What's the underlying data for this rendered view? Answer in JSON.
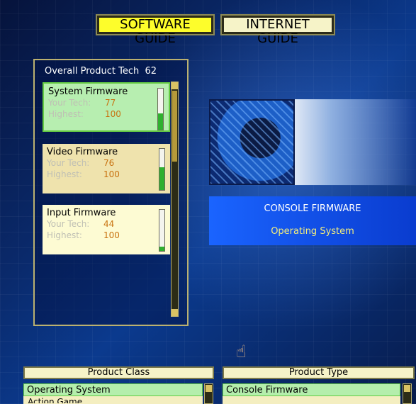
{
  "tabs": {
    "software_guide": "SOFTWARE GUIDE",
    "internet_guide": "INTERNET GUIDE"
  },
  "tech_panel": {
    "overall_label": "Overall Product Tech",
    "overall_value": "62",
    "your_tech_label": "Your Tech:",
    "highest_label": "Highest:",
    "cards": [
      {
        "name": "System Firmware",
        "your_tech": "77",
        "highest": "100",
        "level_fraction": 0.4
      },
      {
        "name": "Video Firmware",
        "your_tech": "76",
        "highest": "100",
        "level_fraction": 0.55
      },
      {
        "name": "Input Firmware",
        "your_tech": "44",
        "highest": "100",
        "level_fraction": 0.1
      }
    ]
  },
  "banner": {
    "title": "CONSOLE FIRMWARE",
    "subtitle": "Operating System"
  },
  "product_class": {
    "header": "Product Class",
    "selected": "Operating System",
    "next_partial": "Action Game"
  },
  "product_type": {
    "header": "Product Type",
    "selected": "Console Firmware"
  },
  "colors": {
    "tab_active": "#fdfd2b",
    "tab_inactive": "#f6f3c8",
    "card_selected": "#b7eeb0",
    "card_video": "#efe3ad",
    "card_input": "#fdfbd3",
    "value_orange": "#c87210",
    "bar_green": "#2fb02f",
    "banner_blue": "#1a64ff",
    "banner_subtitle": "#f3ee7c"
  },
  "icons": {
    "cursor": "hand-pointer-icon"
  }
}
